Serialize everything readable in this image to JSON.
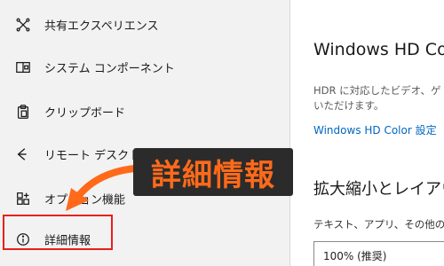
{
  "sidebar": {
    "items": [
      {
        "label": "共有エクスペリエンス",
        "icon": "shared-experiences-icon"
      },
      {
        "label": "システム コンポーネント",
        "icon": "system-components-icon"
      },
      {
        "label": "クリップボード",
        "icon": "clipboard-icon"
      },
      {
        "label": "リモート デスクトップ",
        "icon": "remote-desktop-icon"
      },
      {
        "label": "オプション機能",
        "icon": "optional-features-icon"
      },
      {
        "label": "詳細情報",
        "icon": "info-icon"
      }
    ]
  },
  "annotation": {
    "callout_text": "詳細情報",
    "callout_color": "#ff6a1a",
    "highlight_color": "#e8201a"
  },
  "content": {
    "title": "Windows HD Co",
    "desc_line1": "HDR に対応したビデオ、ゲ",
    "desc_line2": "いただけます。",
    "link": "Windows HD Color 設定",
    "section_title": "拡大縮小とレイアウ",
    "sub_label": "テキスト、アプリ、その他の項",
    "select_value": "100% (推奨)"
  }
}
